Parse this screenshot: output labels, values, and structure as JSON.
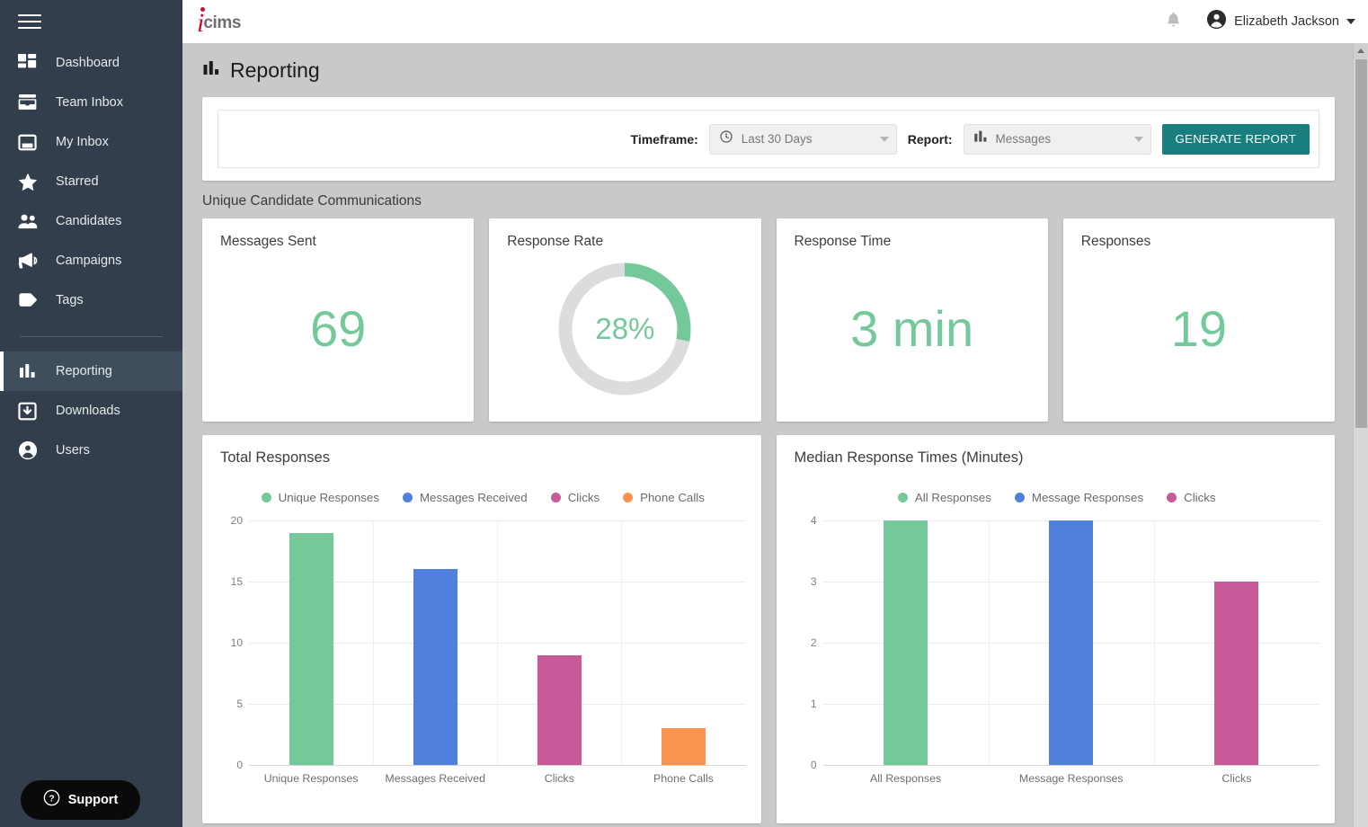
{
  "sidebar": {
    "menu_icon": "hamburger-icon",
    "items": [
      {
        "label": "Dashboard",
        "icon": "dashboard-icon",
        "active": false
      },
      {
        "label": "Team Inbox",
        "icon": "team-inbox-icon",
        "active": false
      },
      {
        "label": "My Inbox",
        "icon": "my-inbox-icon",
        "active": false
      },
      {
        "label": "Starred",
        "icon": "star-icon",
        "active": false
      },
      {
        "label": "Candidates",
        "icon": "people-icon",
        "active": false
      },
      {
        "label": "Campaigns",
        "icon": "megaphone-icon",
        "active": false
      },
      {
        "label": "Tags",
        "icon": "tag-icon",
        "active": false
      }
    ],
    "items_bottom": [
      {
        "label": "Reporting",
        "icon": "bar-chart-icon",
        "active": true
      },
      {
        "label": "Downloads",
        "icon": "download-icon",
        "active": false
      },
      {
        "label": "Users",
        "icon": "user-icon",
        "active": false
      }
    ],
    "support_label": "Support",
    "support_icon": "question-circle-icon",
    "bg_color": "#323e4b",
    "active_bg_color": "#3e4e5d"
  },
  "topbar": {
    "logo_i": "i",
    "logo_text": "cims",
    "logo_color": "#c8102e",
    "notifications_icon": "bell-icon",
    "user_icon": "avatar-icon",
    "user_name": "Elizabeth Jackson",
    "caret_icon": "chevron-down-icon"
  },
  "page": {
    "title": "Reporting",
    "title_icon": "bar-chart-icon"
  },
  "filters": {
    "timeframe_label": "Timeframe:",
    "timeframe_value": "Last 30 Days",
    "timeframe_icon": "clock-icon",
    "report_label": "Report:",
    "report_value": "Messages",
    "report_icon": "bar-chart-icon",
    "generate_label": "GENERATE REPORT",
    "generate_color": "#187e7e"
  },
  "section": {
    "label": "Unique Candidate Communications"
  },
  "stats": [
    {
      "title": "Messages Sent",
      "value": "69",
      "type": "number"
    },
    {
      "title": "Response Rate",
      "value": "28%",
      "type": "donut",
      "percent": 28
    },
    {
      "title": "Response Time",
      "value": "3 min",
      "type": "number"
    },
    {
      "title": "Responses",
      "value": "19",
      "type": "number"
    }
  ],
  "accent_green": "#74c99a",
  "donut_track": "#dcdcdc",
  "chart_data": [
    {
      "type": "bar",
      "title": "Total Responses",
      "categories": [
        "Unique Responses",
        "Messages Received",
        "Clicks",
        "Phone Calls"
      ],
      "values": [
        19,
        16,
        9,
        3
      ],
      "colors": [
        "#74c99a",
        "#4f80dc",
        "#c85a9a",
        "#fb9350"
      ],
      "legend": [
        {
          "name": "Unique Responses",
          "color": "#74c99a"
        },
        {
          "name": "Messages Received",
          "color": "#4f80dc"
        },
        {
          "name": "Clicks",
          "color": "#c85a9a"
        },
        {
          "name": "Phone Calls",
          "color": "#fb9350"
        }
      ],
      "legend_position": "top-center",
      "yticks": [
        0,
        5,
        10,
        15,
        20
      ],
      "ylim": [
        0,
        20
      ],
      "xlabel": "",
      "ylabel": "",
      "grid": true
    },
    {
      "type": "bar",
      "title": "Median Response Times (Minutes)",
      "categories": [
        "All Responses",
        "Message Responses",
        "Clicks"
      ],
      "values": [
        4,
        4,
        3
      ],
      "colors": [
        "#74c99a",
        "#4f80dc",
        "#c85a9a"
      ],
      "legend": [
        {
          "name": "All Responses",
          "color": "#74c99a"
        },
        {
          "name": "Message Responses",
          "color": "#4f80dc"
        },
        {
          "name": "Clicks",
          "color": "#c85a9a"
        }
      ],
      "legend_position": "top-center",
      "yticks": [
        0,
        1,
        2,
        3,
        4
      ],
      "ylim": [
        0,
        4
      ],
      "xlabel": "",
      "ylabel": "",
      "grid": true
    }
  ],
  "scrollbar": {
    "up_icon": "scroll-up-arrow-icon"
  }
}
